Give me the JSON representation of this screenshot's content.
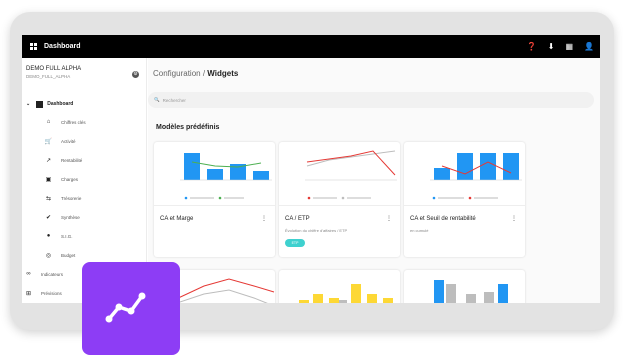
{
  "topbar": {
    "title": "Dashboard",
    "icons": [
      "help-icon",
      "download-icon",
      "apps-icon",
      "user-icon"
    ]
  },
  "org": {
    "name": "DEMO FULL ALPHA",
    "sub": "DEMO_FULL_ALPHA"
  },
  "nav": {
    "head": "Dashboard",
    "items": [
      {
        "label": "Chiffres clés",
        "icon": "home-icon"
      },
      {
        "label": "Activité",
        "icon": "cart-icon"
      },
      {
        "label": "Rentabilité",
        "icon": "trend-icon"
      },
      {
        "label": "Charges",
        "icon": "box-icon"
      },
      {
        "label": "Trésorerie",
        "icon": "arrows-icon"
      },
      {
        "label": "Synthèse",
        "icon": "check-icon"
      },
      {
        "label": "S.I.G.",
        "icon": "circle-icon"
      },
      {
        "label": "Budget",
        "icon": "target-icon"
      },
      {
        "label": "Indicateurs",
        "icon": "infinity-icon"
      },
      {
        "label": "Prévisions",
        "icon": "plus-icon"
      }
    ]
  },
  "breadcrumb": {
    "root": "Configuration",
    "sep": "/",
    "current": "Widgets"
  },
  "search": {
    "placeholder": "Rechercher"
  },
  "section_title": "Modèles prédéfinis",
  "cards": [
    {
      "title": "CA et Marge",
      "desc": "",
      "pill": ""
    },
    {
      "title": "CA / ETP",
      "desc": "Évolution du chiffre d'affaires / ETP",
      "pill": "ETP"
    },
    {
      "title": "CA et Seuil de rentabilité",
      "desc": "en cumulé",
      "pill": ""
    }
  ],
  "colors": {
    "blue": "#2196f3",
    "green": "#4caf50",
    "red": "#e53935",
    "grey": "#bdbdbd",
    "yellow": "#fdd835",
    "purple": "#8d3df5",
    "teal": "#3fd1cf"
  }
}
